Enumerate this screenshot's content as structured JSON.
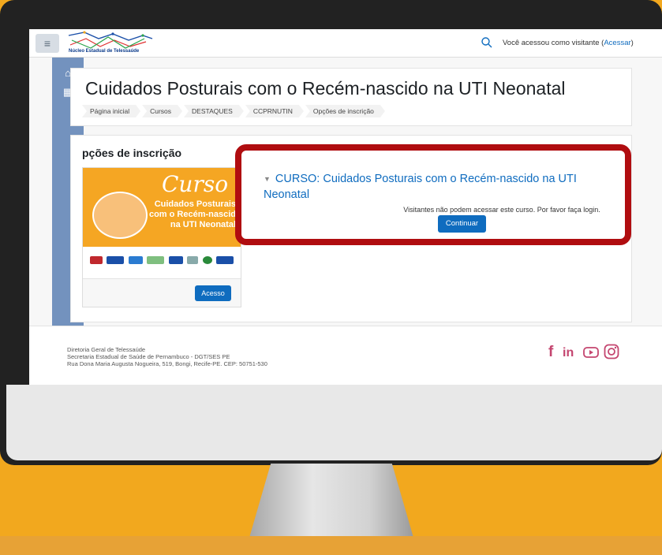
{
  "topbar": {
    "menu_icon": "hamburger-icon",
    "logo_text": "Núcleo Estadual de Telessaúde",
    "search_icon": "search-icon",
    "visitor_prefix": "Você acessou como visitante (",
    "visitor_link": "Acessar",
    "visitor_suffix": ")"
  },
  "sidebar": {
    "items": [
      {
        "icon": "home-icon"
      },
      {
        "icon": "calendar-icon"
      }
    ]
  },
  "header": {
    "title": "Cuidados Posturais com o Recém-nascido na UTI Neonatal",
    "breadcrumb": [
      "Página inicial",
      "Cursos",
      "DESTAQUES",
      "CCPRNUTIN",
      "Opções de inscrição"
    ]
  },
  "main": {
    "section_title": "pções de inscrição",
    "course_card": {
      "image_lines": [
        "Curso",
        "Cuidados Posturais",
        "com o Recém-nascid",
        "na UTI Neonatal"
      ],
      "access_button": "Acesso"
    },
    "enrol": {
      "title": "CURSO: Cuidados Posturais com o Recém-nascido na UTI Neonatal",
      "guest_message": "Visitantes não podem acessar este curso. Por favor faça login.",
      "continue_button": "Continuar"
    }
  },
  "footer": {
    "lines": [
      "Diretoria Geral de Telessaúde",
      "Secretaria Estadual de Saúde de Pernambuco - DGT/SES PE",
      "Rua Dona Maria Augusta Nogueira, 519, Bongi, Recife-PE. CEP: 50751-530"
    ],
    "social": [
      "facebook-icon",
      "linkedin-icon",
      "youtube-icon",
      "instagram-icon"
    ]
  },
  "colors": {
    "background": "#f2a81e",
    "accent": "#0f6cbf",
    "highlight": "#b00d10",
    "sidebar": "#7392be"
  }
}
